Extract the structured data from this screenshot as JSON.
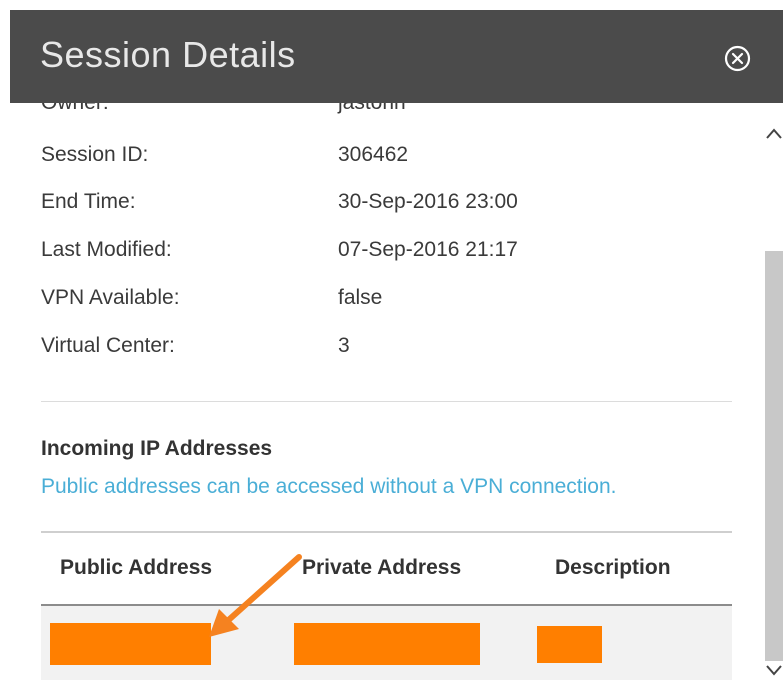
{
  "header": {
    "title": "Session Details"
  },
  "details": [
    {
      "label": "Owner:",
      "value": "jastonn"
    },
    {
      "label": "Session ID:",
      "value": "306462"
    },
    {
      "label": "End Time:",
      "value": "30-Sep-2016 23:00"
    },
    {
      "label": "Last Modified:",
      "value": "07-Sep-2016 21:17"
    },
    {
      "label": "VPN Available:",
      "value": "false"
    },
    {
      "label": "Virtual Center:",
      "value": "3"
    }
  ],
  "incoming": {
    "title": "Incoming IP Addresses",
    "subtitle": "Public addresses can be accessed without a VPN connection.",
    "columns": [
      "Public Address",
      "Private Address",
      "Description"
    ]
  },
  "colors": {
    "header_bg": "#4b4b4b",
    "link": "#4aaed6",
    "redaction": "#ff7f00",
    "annotation_arrow": "#f58220"
  },
  "icons": {
    "close": "close-circle-icon",
    "scroll_up": "chevron-up-icon",
    "scroll_down": "chevron-down-icon"
  }
}
